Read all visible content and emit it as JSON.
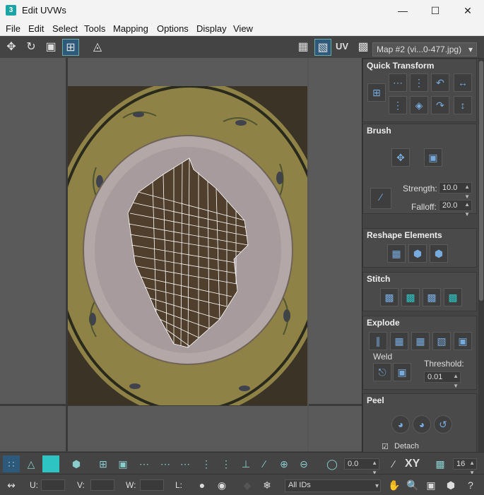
{
  "window": {
    "title": "Edit UVWs",
    "app_icon": "3"
  },
  "menu": [
    "File",
    "Edit",
    "Select",
    "Tools",
    "Mapping",
    "Options",
    "Display",
    "View"
  ],
  "toolbar": {
    "uv_label": "UV",
    "map_dropdown": "Map #2 (vi...0-477.jpg)"
  },
  "panel": {
    "quick_transform": {
      "title": "Quick Transform"
    },
    "brush": {
      "title": "Brush",
      "strength_label": "Strength:",
      "strength_value": "10.0",
      "falloff_label": "Falloff:",
      "falloff_value": "20.0"
    },
    "reshape": {
      "title": "Reshape Elements"
    },
    "stitch": {
      "title": "Stitch"
    },
    "explode": {
      "title": "Explode",
      "weld_label": "Weld",
      "threshold_label": "Threshold:",
      "threshold_value": "0.01"
    },
    "peel": {
      "title": "Peel",
      "detach_label": "Detach"
    }
  },
  "bottom": {
    "rotate_value": "0.0",
    "xy_label": "XY",
    "snap_value": "16",
    "u_label": "U:",
    "v_label": "V:",
    "w_label": "W:",
    "l_label": "L:",
    "ids_dropdown": "All IDs"
  },
  "colors": {
    "accent": "#2ec4c4",
    "panel_bg": "#444444",
    "title_bg": "#f3f3f3"
  }
}
